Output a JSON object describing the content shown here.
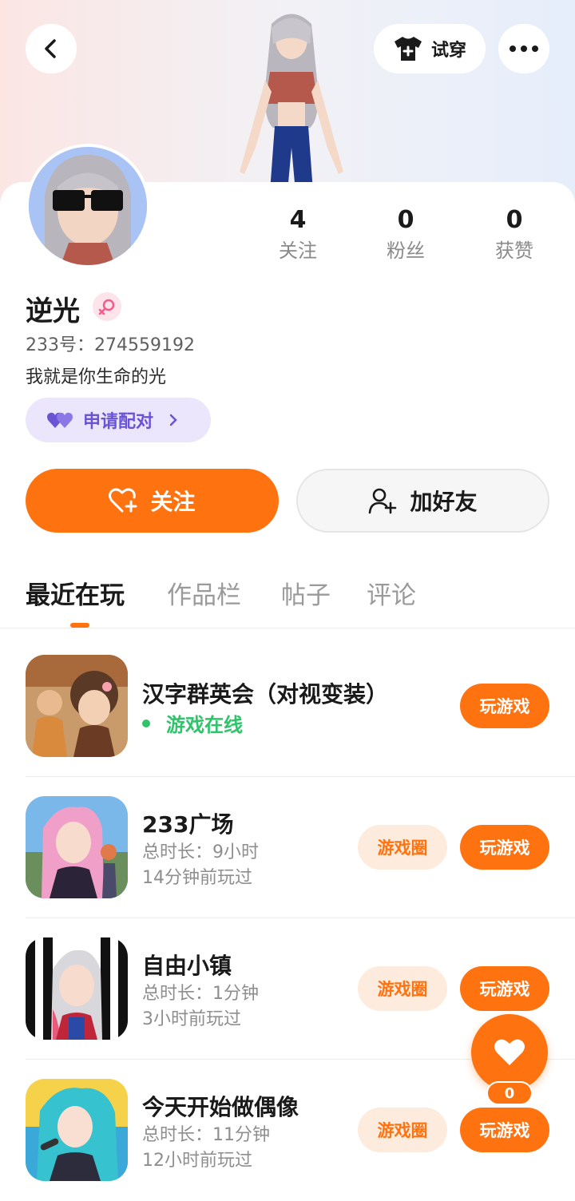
{
  "header": {
    "try_on_label": "试穿",
    "icons": {
      "back": "chevron-left-icon",
      "try_on": "shirt-plus-icon",
      "more": "more-dots-icon"
    }
  },
  "profile": {
    "name": "逆光",
    "gender": "female",
    "uid": "233号：274559192",
    "bio": "我就是你生命的光",
    "pair_label": "申请配对"
  },
  "stats": [
    {
      "value": "4",
      "label": "关注"
    },
    {
      "value": "0",
      "label": "粉丝"
    },
    {
      "value": "0",
      "label": "获赞"
    }
  ],
  "actions": {
    "follow_label": "关注",
    "add_friend_label": "加好友"
  },
  "tabs": [
    {
      "label": "最近在玩",
      "active": true
    },
    {
      "label": "作品栏",
      "active": false
    },
    {
      "label": "帖子",
      "active": false
    },
    {
      "label": "评论",
      "active": false
    }
  ],
  "games": [
    {
      "title": "汉字群英会（对视变装）",
      "status": "游戏在线",
      "play_label": "玩游戏"
    },
    {
      "title": "233广场",
      "duration": "总时长：9小时",
      "last_played": "14分钟前玩过",
      "circle_label": "游戏圈",
      "play_label": "玩游戏"
    },
    {
      "title": "自由小镇",
      "duration": "总时长：1分钟",
      "last_played": "3小时前玩过",
      "circle_label": "游戏圈",
      "play_label": "玩游戏"
    },
    {
      "title": "今天开始做偶像",
      "duration": "总时长：11分钟",
      "last_played": "12小时前玩过",
      "circle_label": "游戏圈",
      "play_label": "玩游戏"
    }
  ],
  "like": {
    "count": "0"
  },
  "colors": {
    "accent": "#ff7210",
    "online": "#2fc46a",
    "pair": "#6a54d6"
  }
}
